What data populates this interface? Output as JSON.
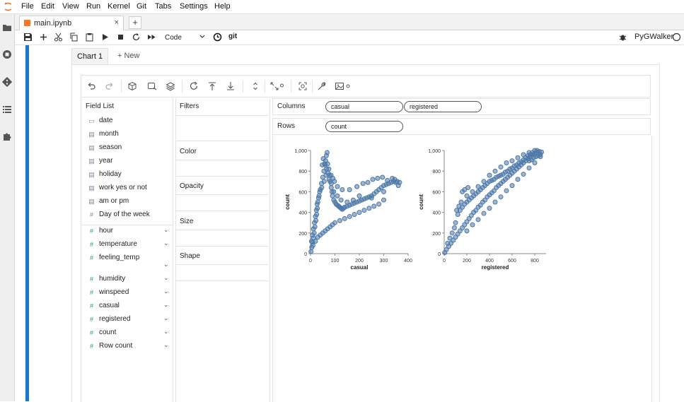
{
  "menu": [
    "File",
    "Edit",
    "View",
    "Run",
    "Kernel",
    "Git",
    "Tabs",
    "Settings",
    "Help"
  ],
  "file_tab": {
    "name": "main.ipynb",
    "close": "×"
  },
  "new_tab_symbol": "+",
  "toolbar": {
    "cell_type": "Code",
    "git": "git",
    "kernel": "PyGWalker"
  },
  "chart_tabs": [
    "Chart 1",
    "+ New"
  ],
  "field_list": {
    "title": "Field List",
    "dimensions": [
      {
        "name": "date",
        "icon": "calendar-icon"
      },
      {
        "name": "month",
        "icon": "text-type-icon"
      },
      {
        "name": "season",
        "icon": "text-type-icon"
      },
      {
        "name": "year",
        "icon": "text-type-icon"
      },
      {
        "name": "holiday",
        "icon": "text-type-icon"
      },
      {
        "name": "work yes or not",
        "icon": "text-type-icon"
      },
      {
        "name": "am or pm",
        "icon": "text-type-icon"
      },
      {
        "name": "Day of the week",
        "icon": "hash-icon"
      }
    ],
    "measures": [
      "hour",
      "temperature",
      "feeling_temp",
      "humidity",
      "winspeed",
      "casual",
      "registered",
      "count",
      "Row count"
    ]
  },
  "encodings": [
    "Filters",
    "Color",
    "Opacity",
    "Size",
    "Shape"
  ],
  "shelves": {
    "columns_label": "Columns",
    "columns": [
      "casual",
      "registered"
    ],
    "rows_label": "Rows",
    "rows": [
      "count"
    ]
  },
  "colors": {
    "accent": "#1976d2",
    "point": "#4c78a8"
  },
  "chart_data": [
    {
      "type": "scatter",
      "xlabel": "casual",
      "ylabel": "count",
      "xlim": [
        0,
        400
      ],
      "ylim": [
        0,
        1000
      ],
      "xticks": [
        "0",
        "100",
        "200",
        "300",
        "400"
      ],
      "yticks": [
        "0",
        "200",
        "400",
        "600",
        "800",
        "1,000"
      ],
      "points": [
        [
          2,
          20
        ],
        [
          5,
          60
        ],
        [
          8,
          110
        ],
        [
          12,
          150
        ],
        [
          15,
          200
        ],
        [
          18,
          260
        ],
        [
          22,
          320
        ],
        [
          25,
          380
        ],
        [
          28,
          440
        ],
        [
          30,
          500
        ],
        [
          35,
          560
        ],
        [
          40,
          620
        ],
        [
          45,
          680
        ],
        [
          50,
          740
        ],
        [
          55,
          800
        ],
        [
          60,
          860
        ],
        [
          62,
          900
        ],
        [
          65,
          950
        ],
        [
          68,
          980
        ],
        [
          70,
          870
        ],
        [
          75,
          820
        ],
        [
          78,
          760
        ],
        [
          80,
          700
        ],
        [
          85,
          640
        ],
        [
          88,
          600
        ],
        [
          90,
          560
        ],
        [
          95,
          520
        ],
        [
          100,
          500
        ],
        [
          105,
          480
        ],
        [
          110,
          470
        ],
        [
          115,
          460
        ],
        [
          120,
          450
        ],
        [
          125,
          440
        ],
        [
          130,
          430
        ],
        [
          135,
          440
        ],
        [
          140,
          450
        ],
        [
          150,
          460
        ],
        [
          160,
          470
        ],
        [
          170,
          480
        ],
        [
          180,
          490
        ],
        [
          190,
          500
        ],
        [
          200,
          510
        ],
        [
          210,
          520
        ],
        [
          220,
          530
        ],
        [
          230,
          540
        ],
        [
          240,
          550
        ],
        [
          250,
          560
        ],
        [
          260,
          580
        ],
        [
          270,
          600
        ],
        [
          280,
          620
        ],
        [
          290,
          640
        ],
        [
          300,
          660
        ],
        [
          310,
          670
        ],
        [
          320,
          680
        ],
        [
          330,
          690
        ],
        [
          340,
          700
        ],
        [
          350,
          690
        ],
        [
          360,
          660
        ],
        [
          300,
          520
        ],
        [
          280,
          480
        ],
        [
          260,
          460
        ],
        [
          240,
          440
        ],
        [
          220,
          420
        ],
        [
          200,
          400
        ],
        [
          180,
          380
        ],
        [
          160,
          360
        ],
        [
          140,
          340
        ],
        [
          120,
          320
        ],
        [
          100,
          300
        ],
        [
          90,
          280
        ],
        [
          80,
          260
        ],
        [
          70,
          240
        ],
        [
          60,
          220
        ],
        [
          50,
          200
        ],
        [
          40,
          180
        ],
        [
          30,
          160
        ],
        [
          20,
          120
        ],
        [
          10,
          80
        ],
        [
          48,
          860
        ],
        [
          52,
          920
        ],
        [
          58,
          870
        ],
        [
          66,
          820
        ],
        [
          72,
          780
        ],
        [
          84,
          760
        ],
        [
          92,
          730
        ],
        [
          98,
          700
        ],
        [
          110,
          650
        ],
        [
          130,
          620
        ],
        [
          160,
          620
        ],
        [
          190,
          650
        ],
        [
          215,
          680
        ],
        [
          235,
          690
        ],
        [
          255,
          720
        ],
        [
          275,
          730
        ],
        [
          295,
          740
        ],
        [
          315,
          710
        ],
        [
          335,
          730
        ],
        [
          345,
          720
        ],
        [
          355,
          700
        ],
        [
          365,
          690
        ],
        [
          300,
          600
        ],
        [
          250,
          540
        ],
        [
          200,
          560
        ],
        [
          175,
          520
        ],
        [
          150,
          500
        ],
        [
          125,
          520
        ],
        [
          110,
          560
        ],
        [
          95,
          600
        ],
        [
          85,
          680
        ],
        [
          76,
          720
        ],
        [
          64,
          760
        ],
        [
          56,
          700
        ],
        [
          46,
          640
        ],
        [
          38,
          600
        ],
        [
          33,
          540
        ],
        [
          27,
          480
        ],
        [
          24,
          420
        ],
        [
          20,
          360
        ],
        [
          16,
          300
        ],
        [
          12,
          240
        ],
        [
          8,
          180
        ],
        [
          4,
          120
        ]
      ]
    },
    {
      "type": "scatter",
      "xlabel": "registered",
      "ylabel": "count",
      "xlim": [
        0,
        900
      ],
      "ylim": [
        0,
        1000
      ],
      "xticks": [
        "0",
        "200",
        "400",
        "600",
        "800"
      ],
      "yticks": [
        "0",
        "200",
        "400",
        "600",
        "800",
        "1,000"
      ],
      "points": [
        [
          5,
          10
        ],
        [
          20,
          40
        ],
        [
          40,
          70
        ],
        [
          60,
          100
        ],
        [
          80,
          130
        ],
        [
          100,
          160
        ],
        [
          120,
          190
        ],
        [
          140,
          220
        ],
        [
          160,
          250
        ],
        [
          180,
          280
        ],
        [
          200,
          310
        ],
        [
          220,
          340
        ],
        [
          240,
          370
        ],
        [
          260,
          400
        ],
        [
          280,
          420
        ],
        [
          300,
          450
        ],
        [
          320,
          470
        ],
        [
          340,
          500
        ],
        [
          360,
          520
        ],
        [
          380,
          550
        ],
        [
          400,
          570
        ],
        [
          420,
          590
        ],
        [
          440,
          610
        ],
        [
          460,
          640
        ],
        [
          480,
          660
        ],
        [
          500,
          680
        ],
        [
          520,
          700
        ],
        [
          540,
          720
        ],
        [
          560,
          740
        ],
        [
          580,
          760
        ],
        [
          600,
          780
        ],
        [
          620,
          800
        ],
        [
          640,
          820
        ],
        [
          660,
          840
        ],
        [
          680,
          860
        ],
        [
          700,
          880
        ],
        [
          720,
          900
        ],
        [
          740,
          920
        ],
        [
          760,
          940
        ],
        [
          780,
          960
        ],
        [
          800,
          970
        ],
        [
          820,
          980
        ],
        [
          840,
          990
        ],
        [
          860,
          985
        ],
        [
          850,
          960
        ],
        [
          830,
          950
        ],
        [
          810,
          940
        ],
        [
          790,
          930
        ],
        [
          770,
          910
        ],
        [
          750,
          900
        ],
        [
          100,
          300
        ],
        [
          120,
          380
        ],
        [
          90,
          250
        ],
        [
          70,
          200
        ],
        [
          50,
          150
        ],
        [
          30,
          100
        ],
        [
          140,
          420
        ],
        [
          160,
          450
        ],
        [
          180,
          480
        ],
        [
          200,
          500
        ],
        [
          220,
          520
        ],
        [
          240,
          540
        ],
        [
          260,
          560
        ],
        [
          280,
          580
        ],
        [
          300,
          600
        ],
        [
          320,
          620
        ],
        [
          340,
          640
        ],
        [
          360,
          660
        ],
        [
          380,
          680
        ],
        [
          400,
          700
        ],
        [
          420,
          710
        ],
        [
          440,
          720
        ],
        [
          460,
          740
        ],
        [
          480,
          750
        ],
        [
          500,
          760
        ],
        [
          520,
          770
        ],
        [
          540,
          790
        ],
        [
          560,
          800
        ],
        [
          580,
          820
        ],
        [
          600,
          830
        ],
        [
          620,
          850
        ],
        [
          640,
          860
        ],
        [
          660,
          880
        ],
        [
          680,
          890
        ],
        [
          700,
          910
        ],
        [
          720,
          930
        ],
        [
          740,
          950
        ],
        [
          760,
          960
        ],
        [
          780,
          980
        ],
        [
          800,
          1000
        ],
        [
          820,
          1000
        ],
        [
          160,
          600
        ],
        [
          180,
          620
        ],
        [
          210,
          640
        ],
        [
          150,
          500
        ],
        [
          130,
          460
        ],
        [
          110,
          420
        ],
        [
          200,
          560
        ],
        [
          250,
          600
        ],
        [
          300,
          650
        ],
        [
          350,
          700
        ],
        [
          400,
          760
        ],
        [
          450,
          800
        ],
        [
          500,
          840
        ],
        [
          550,
          880
        ],
        [
          600,
          900
        ],
        [
          650,
          930
        ],
        [
          700,
          960
        ],
        [
          750,
          980
        ],
        [
          200,
          220
        ],
        [
          300,
          330
        ],
        [
          400,
          440
        ],
        [
          500,
          550
        ],
        [
          600,
          660
        ],
        [
          700,
          770
        ],
        [
          800,
          880
        ],
        [
          250,
          280
        ],
        [
          350,
          390
        ],
        [
          450,
          500
        ],
        [
          550,
          610
        ],
        [
          650,
          720
        ],
        [
          750,
          830
        ],
        [
          850,
          940
        ]
      ]
    }
  ]
}
